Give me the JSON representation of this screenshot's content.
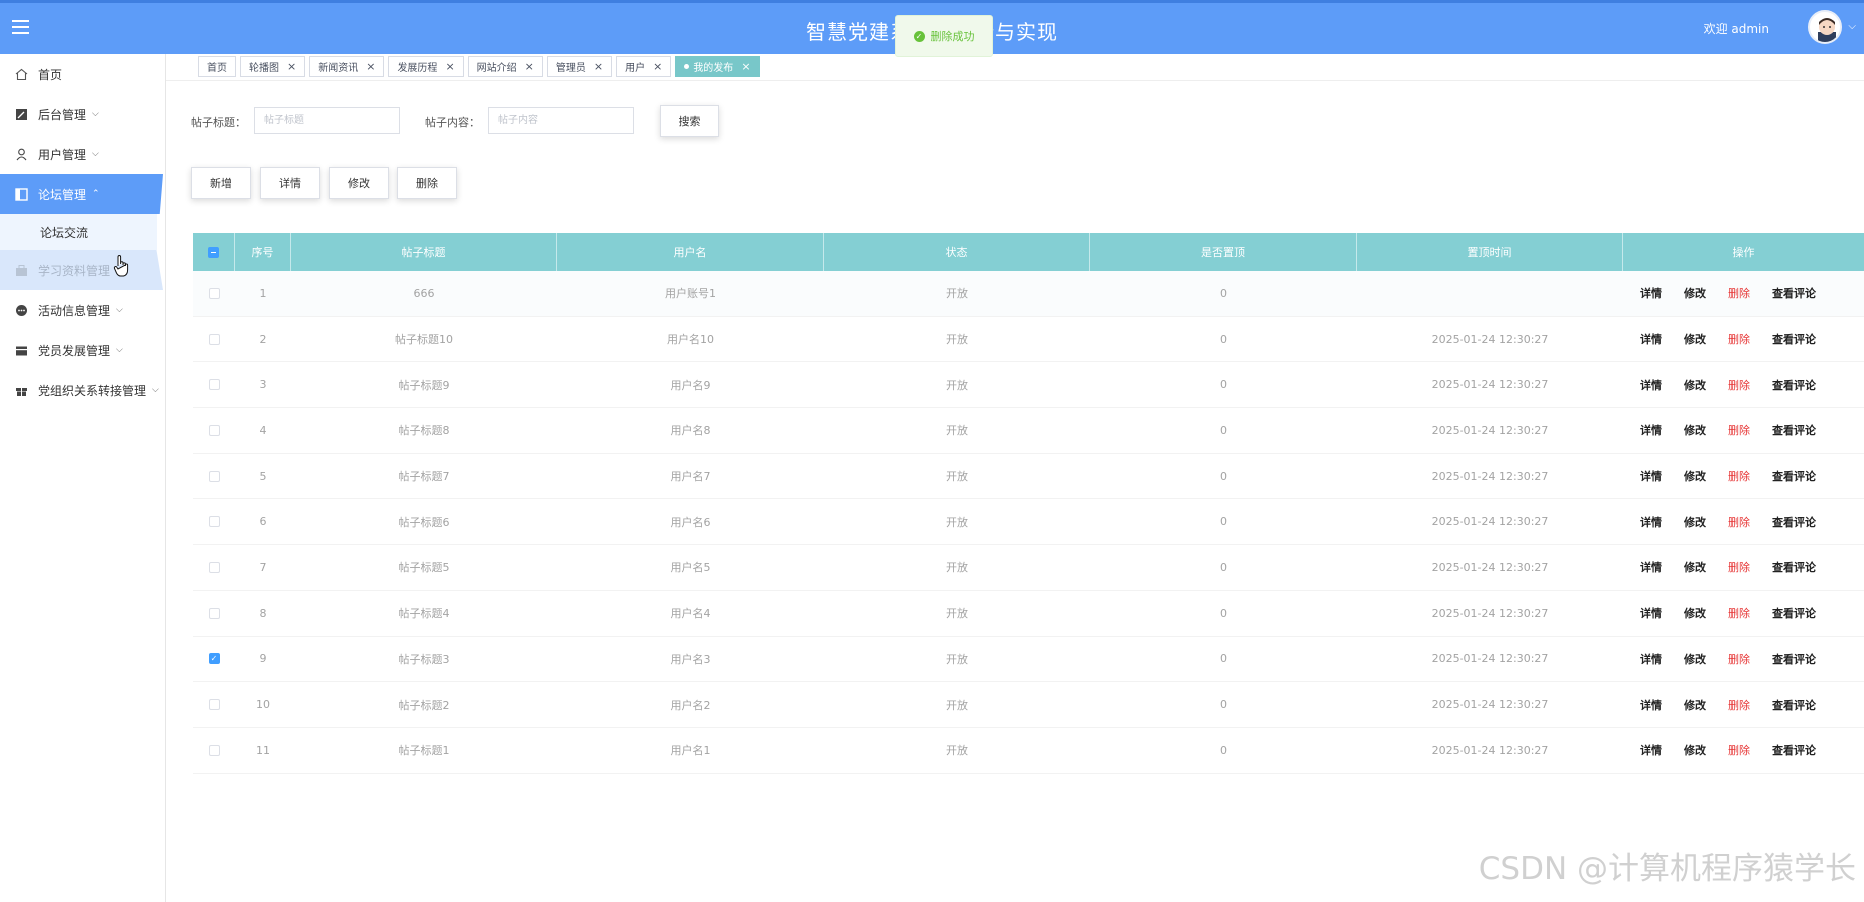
{
  "header": {
    "title": "智慧党建系统的设计与实现",
    "welcome": "欢迎 admin"
  },
  "toast": {
    "message": "删除成功"
  },
  "sidebar": {
    "items": [
      {
        "label": "首页",
        "icon": "home-icon"
      },
      {
        "label": "后台管理",
        "icon": "edit-icon"
      },
      {
        "label": "用户管理",
        "icon": "user-icon"
      },
      {
        "label": "论坛管理",
        "icon": "panel-icon"
      },
      {
        "label": "论坛交流"
      },
      {
        "label": "学习资料管理",
        "icon": "bag-icon"
      },
      {
        "label": "活动信息管理",
        "icon": "chat-icon"
      },
      {
        "label": "党员发展管理",
        "icon": "wallet-icon"
      },
      {
        "label": "党组织关系转接管理",
        "icon": "gift-icon"
      }
    ]
  },
  "tabs": [
    "首页",
    "轮播图",
    "新闻资讯",
    "发展历程",
    "网站介绍",
    "管理员",
    "用户",
    "我的发布"
  ],
  "search": {
    "title_label": "帖子标题：",
    "title_placeholder": "帖子标题",
    "content_label": "帖子内容：",
    "content_placeholder": "帖子内容",
    "button": "搜索"
  },
  "actions": {
    "add": "新增",
    "detail": "详情",
    "edit": "修改",
    "delete": "删除"
  },
  "table": {
    "headers": [
      "序号",
      "帖子标题",
      "用户名",
      "状态",
      "是否置顶",
      "置顶时间",
      "操作"
    ],
    "ops": [
      "详情",
      "修改",
      "删除",
      "查看评论"
    ],
    "rows": [
      [
        "1",
        "666",
        "用户账号1",
        "开放",
        "0",
        ""
      ],
      [
        "2",
        "帖子标题10",
        "用户名10",
        "开放",
        "0",
        "2025-01-24 12:30:27"
      ],
      [
        "3",
        "帖子标题9",
        "用户名9",
        "开放",
        "0",
        "2025-01-24 12:30:27"
      ],
      [
        "4",
        "帖子标题8",
        "用户名8",
        "开放",
        "0",
        "2025-01-24 12:30:27"
      ],
      [
        "5",
        "帖子标题7",
        "用户名7",
        "开放",
        "0",
        "2025-01-24 12:30:27"
      ],
      [
        "6",
        "帖子标题6",
        "用户名6",
        "开放",
        "0",
        "2025-01-24 12:30:27"
      ],
      [
        "7",
        "帖子标题5",
        "用户名5",
        "开放",
        "0",
        "2025-01-24 12:30:27"
      ],
      [
        "8",
        "帖子标题4",
        "用户名4",
        "开放",
        "0",
        "2025-01-24 12:30:27"
      ],
      [
        "9",
        "帖子标题3",
        "用户名3",
        "开放",
        "0",
        "2025-01-24 12:30:27"
      ],
      [
        "10",
        "帖子标题2",
        "用户名2",
        "开放",
        "0",
        "2025-01-24 12:30:27"
      ],
      [
        "11",
        "帖子标题1",
        "用户名1",
        "开放",
        "0",
        "2025-01-24 12:30:27"
      ]
    ],
    "checked_rows": [
      9
    ]
  },
  "watermark": "CSDN @计算机程序猿学长",
  "colors": {
    "header": "#5d9cf8",
    "table_header": "#84cfd3",
    "delete": "#e63333",
    "toast": "#67c23a"
  }
}
